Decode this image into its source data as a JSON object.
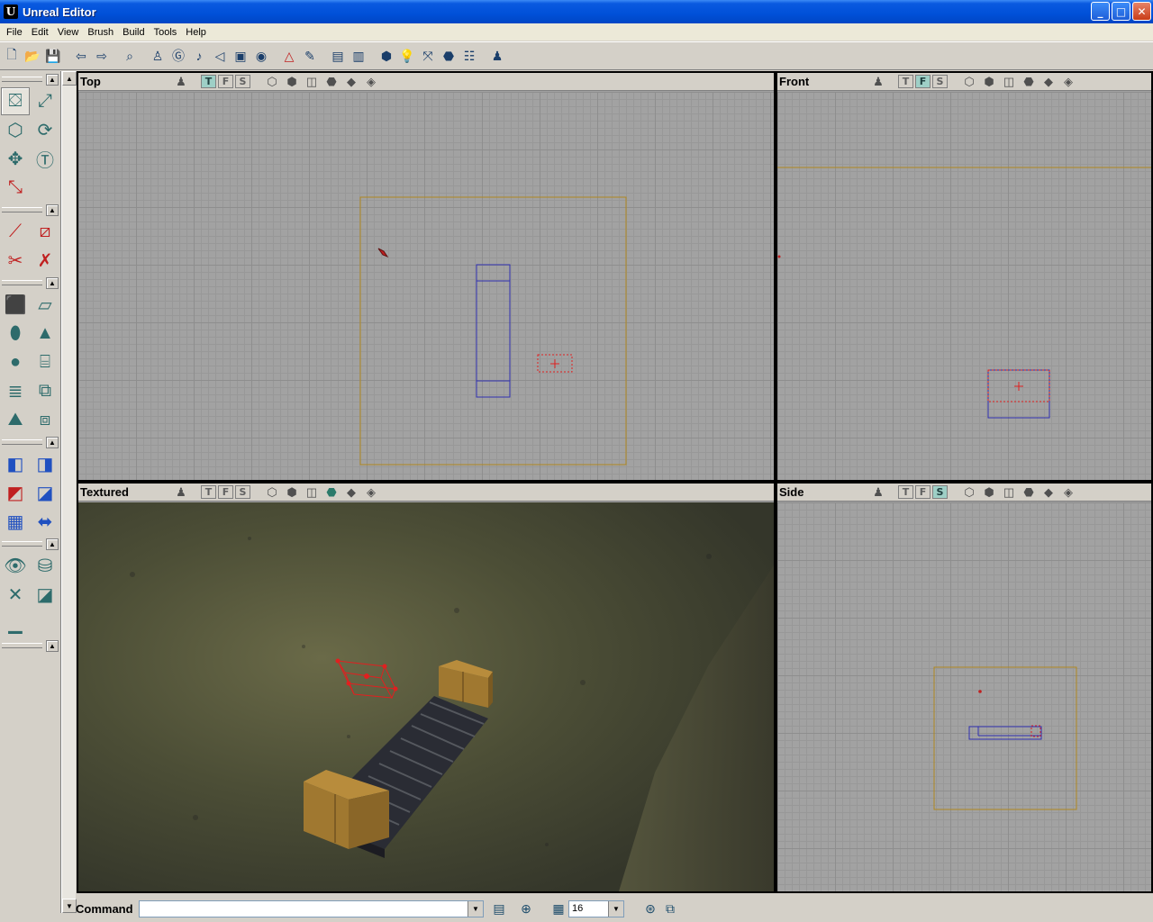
{
  "window": {
    "title": "Unreal Editor",
    "icon_letter": "U"
  },
  "window_controls": {
    "minimize": "_",
    "maximize": "□",
    "close": "✕"
  },
  "menu": [
    "File",
    "Edit",
    "View",
    "Brush",
    "Build",
    "Tools",
    "Help"
  ],
  "toolbar_icons": [
    "new-map-icon",
    "open-map-icon",
    "save-map-icon",
    "undo-icon",
    "redo-icon",
    "search-actors-icon",
    "actor-browser-icon",
    "group-browser-icon",
    "music-browser-icon",
    "sound-browser-icon",
    "texture-browser-icon",
    "mesh-viewer-icon",
    "2d-shape-editor-icon",
    "unrealscript-editor-icon",
    "actor-properties-icon",
    "surface-properties-icon",
    "build-geometry-icon",
    "build-lighting-icon",
    "build-paths-icon",
    "build-all-icon",
    "build-options-icon",
    "play-map-icon"
  ],
  "viewports": {
    "top": {
      "title": "Top",
      "buttons": [
        "T",
        "F",
        "S"
      ],
      "active_button": "T"
    },
    "front": {
      "title": "Front",
      "buttons": [
        "T",
        "F",
        "S"
      ],
      "active_button": "F"
    },
    "textured": {
      "title": "Textured",
      "buttons": [
        "T",
        "F",
        "S"
      ],
      "active_button": ""
    },
    "side": {
      "title": "Side",
      "buttons": [
        "T",
        "F",
        "S"
      ],
      "active_button": "S"
    }
  },
  "statusbar": {
    "command_label": "Command",
    "command_value": "",
    "grid_size": "16"
  },
  "colors": {
    "titlebar": "#0050d8",
    "grid_bg": "#a2a2a2",
    "builder_brush": "#e02020",
    "brush_outline": "#3030b0",
    "world_bounds": "#b08820"
  }
}
